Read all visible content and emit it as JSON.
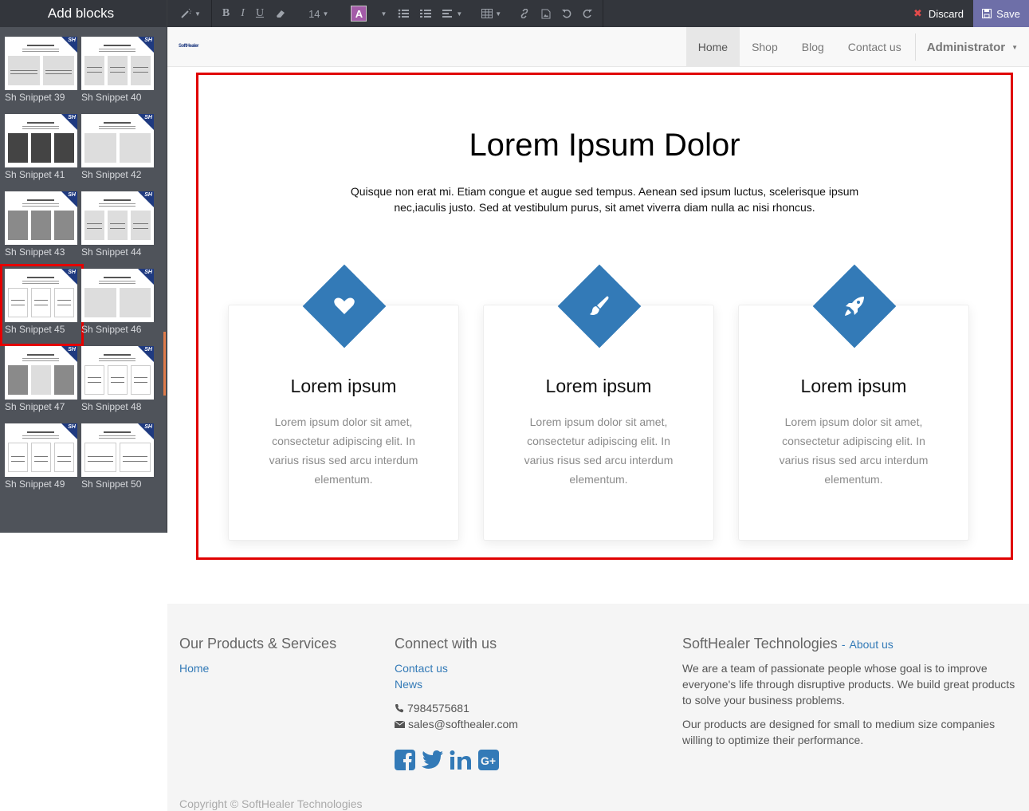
{
  "sidebar": {
    "title": "Add blocks",
    "snippets": [
      {
        "label": "Sh Snippet 39"
      },
      {
        "label": "Sh Snippet 40"
      },
      {
        "label": "Sh Snippet 41"
      },
      {
        "label": "Sh Snippet 42"
      },
      {
        "label": "Sh Snippet 43"
      },
      {
        "label": "Sh Snippet 44"
      },
      {
        "label": "Sh Snippet 45"
      },
      {
        "label": "Sh Snippet 46"
      },
      {
        "label": "Sh Snippet 47"
      },
      {
        "label": "Sh Snippet 48"
      },
      {
        "label": "Sh Snippet 49"
      },
      {
        "label": "Sh Snippet 50"
      }
    ],
    "selected_snippet": "Sh Snippet 45",
    "thumb_badge": "SH"
  },
  "toolbar": {
    "bold": "B",
    "italic": "I",
    "underline": "U",
    "font_size": "14",
    "color_letter": "A",
    "discard_label": "Discard",
    "save_label": "Save"
  },
  "nav": {
    "brand": "SoftHealer",
    "items": [
      "Home",
      "Shop",
      "Blog",
      "Contact us"
    ],
    "active": "Home",
    "user": "Administrator"
  },
  "section": {
    "title": "Lorem Ipsum Dolor",
    "subtitle": "Quisque non erat mi. Etiam congue et augue sed tempus. Aenean sed ipsum luctus, scelerisque ipsum nec,iaculis justo. Sed at vestibulum purus, sit amet viverra diam nulla ac nisi rhoncus.",
    "cards": [
      {
        "icon": "heart-icon",
        "title": "Lorem ipsum",
        "text": "Lorem ipsum dolor sit amet, consectetur adipiscing elit. In varius risus sed arcu interdum elementum."
      },
      {
        "icon": "paint-brush-icon",
        "title": "Lorem ipsum",
        "text": "Lorem ipsum dolor sit amet, consectetur adipiscing elit. In varius risus sed arcu interdum elementum."
      },
      {
        "icon": "rocket-icon",
        "title": "Lorem ipsum",
        "text": "Lorem ipsum dolor sit amet, consectetur adipiscing elit. In varius risus sed arcu interdum elementum."
      }
    ],
    "accent_color": "#337ab7",
    "highlight_color": "#e00000"
  },
  "footer": {
    "products_heading": "Our Products & Services",
    "products_links": [
      "Home"
    ],
    "connect_heading": "Connect with us",
    "connect_links": [
      "Contact us",
      "News"
    ],
    "phone": "7984575681",
    "email": "sales@softhealer.com",
    "company_heading": "SoftHealer Technologies",
    "about_separator": "-",
    "about_link": "About us",
    "about_text_1": "We are a team of passionate people whose goal is to improve everyone's life through disruptive products. We build great products to solve your business problems.",
    "about_text_2": "Our products are designed for small to medium size companies willing to optimize their performance.",
    "copyright": "Copyright © SoftHealer Technologies"
  }
}
